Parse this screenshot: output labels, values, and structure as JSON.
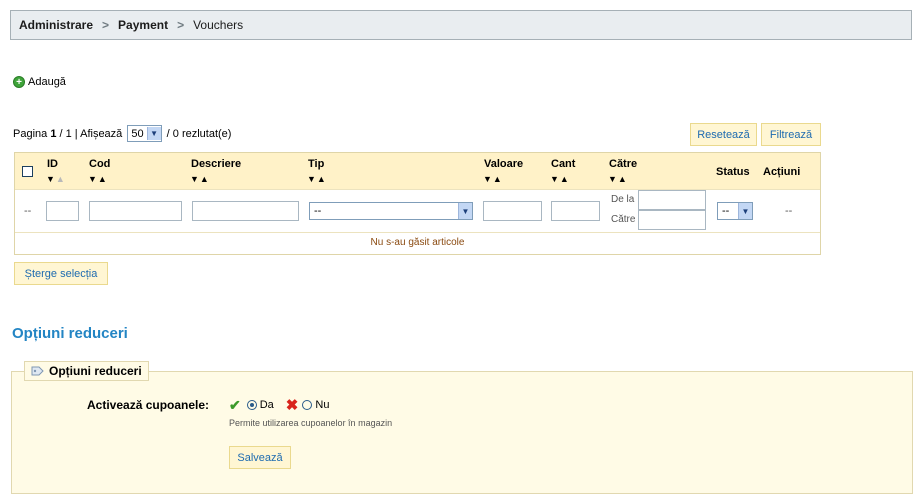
{
  "breadcrumb": {
    "items": [
      "Administrare",
      "Payment",
      "Vouchers"
    ],
    "separator": ">"
  },
  "toolbar": {
    "add_label": "Adaugă"
  },
  "pagination": {
    "prefix": "Pagina",
    "current": "1",
    "total_text": " / 1 | Afișează ",
    "per_page": "50",
    "results_text": " / 0 rezlutat(e)"
  },
  "actions": {
    "reset_label": "Resetează",
    "filter_label": "Filtrează",
    "delete_selection_label": "Șterge selecția"
  },
  "grid": {
    "columns": {
      "id": "ID",
      "code": "Cod",
      "description": "Descriere",
      "type": "Tip",
      "value": "Valoare",
      "qty": "Cant",
      "to": "Către",
      "status": "Status",
      "actions": "Acțiuni"
    },
    "filter": {
      "dash": "--",
      "type_value": "--",
      "date_from_label": "De la",
      "date_to_label": "Către",
      "status_value": "--",
      "actions_dash": "--"
    },
    "empty_message": "Nu s-au găsit articole"
  },
  "options": {
    "section_title": "Opțiuni reduceri",
    "fieldset_legend": "Opțiuni reduceri",
    "enable_label": "Activează cupoanele:",
    "yes_label": "Da",
    "no_label": "Nu",
    "selected": "Da",
    "hint": "Permite utilizarea cupoanelor în magazin",
    "save_label": "Salvează"
  },
  "colors": {
    "accent": "#2385c4",
    "button_bg": "#fff6d3",
    "header_bg": "#fff2c8",
    "panel_bg": "#fffbe6"
  }
}
